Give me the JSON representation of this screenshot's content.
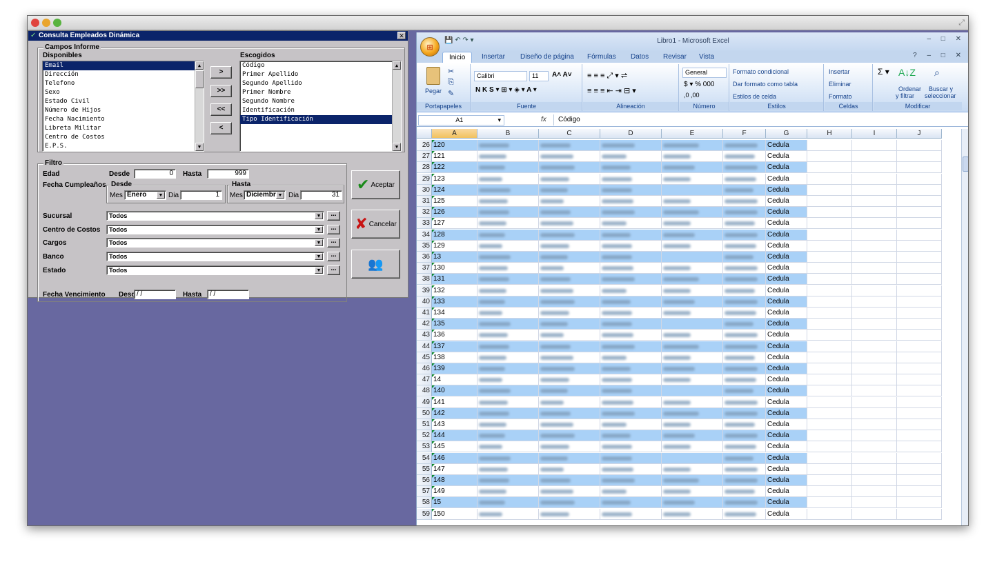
{
  "dialog": {
    "title": "Consulta Empleados Dinámica",
    "campos_title": "Campos Informe",
    "disponibles_label": "Disponibles",
    "escogidos_label": "Escogidos",
    "disponibles": [
      "Email",
      "Dirección",
      "Telefono",
      "Sexo",
      "Estado Civil",
      "Número de Hijos",
      "Fecha Nacimiento",
      "Libreta Militar",
      "Centro de Costos",
      "E.P.S."
    ],
    "escogidos": [
      "Código",
      "Primer Apellido",
      "Segundo Apellido",
      "Primer Nombre",
      "Segundo Nombre",
      "Identificación",
      "Tipo Identificación"
    ],
    "move_buttons": [
      ">",
      ">>",
      "<<",
      "<"
    ],
    "filtro_title": "Filtro",
    "edad_label": "Edad",
    "desde_label": "Desde",
    "hasta_label": "Hasta",
    "edad_desde": "0",
    "edad_hasta": "999",
    "fecha_cumple_label": "Fecha Cumpleaños",
    "mes_label": "Mes",
    "dia_label": "Dia",
    "mes_desde": "Enero",
    "dia_desde": "1",
    "mes_hasta": "Diciembr",
    "dia_hasta": "31",
    "filters": [
      {
        "label": "Sucursal",
        "value": "Todos"
      },
      {
        "label": "Centro de Costos",
        "value": "Todos"
      },
      {
        "label": "Cargos",
        "value": "Todos"
      },
      {
        "label": "Banco",
        "value": "Todos"
      },
      {
        "label": "Estado",
        "value": "Todos"
      }
    ],
    "ellipsis": "...",
    "fecha_venc_label": "Fecha Vencimiento",
    "fecha_venc_desde": "/ /",
    "fecha_venc_hasta": "/ /",
    "aceptar": "Aceptar",
    "cancelar": "Cancelar"
  },
  "excel": {
    "title": "Libro1 - Microsoft Excel",
    "tabs": [
      "Inicio",
      "Insertar",
      "Diseño de página",
      "Fórmulas",
      "Datos",
      "Revisar",
      "Vista"
    ],
    "ribbon": {
      "pegar": "Pegar",
      "portapapeles": "Portapapeles",
      "font_name": "Calibri",
      "font_size": "11",
      "fuente": "Fuente",
      "alineacion": "Alineación",
      "number_format": "General",
      "numero": "Número",
      "formato_condicional": "Formato condicional",
      "dar_formato_tabla": "Dar formato como tabla",
      "estilos_celda": "Estilos de celda",
      "estilos": "Estilos",
      "insertar": "Insertar",
      "eliminar": "Eliminar",
      "formato": "Formato",
      "celdas": "Celdas",
      "ordenar": "Ordenar",
      "filtrar": "y filtrar",
      "buscar": "Buscar y",
      "seleccionar": "seleccionar",
      "modificar": "Modificar"
    },
    "name_box": "A1",
    "formula": "Código",
    "fx": "fx",
    "columns": [
      "A",
      "B",
      "C",
      "D",
      "E",
      "F",
      "G",
      "H",
      "I",
      "J"
    ],
    "rows": [
      {
        "n": "26",
        "a": "120",
        "g": "Cedula"
      },
      {
        "n": "27",
        "a": "121",
        "g": "Cedula"
      },
      {
        "n": "28",
        "a": "122",
        "g": "Cedula"
      },
      {
        "n": "29",
        "a": "123",
        "g": "Cedula"
      },
      {
        "n": "30",
        "a": "124",
        "g": "Cedula"
      },
      {
        "n": "31",
        "a": "125",
        "g": "Cedula"
      },
      {
        "n": "32",
        "a": "126",
        "g": "Cedula"
      },
      {
        "n": "33",
        "a": "127",
        "g": "Cedula"
      },
      {
        "n": "34",
        "a": "128",
        "g": "Cedula"
      },
      {
        "n": "35",
        "a": "129",
        "g": "Cedula"
      },
      {
        "n": "36",
        "a": "13",
        "g": "Cedula"
      },
      {
        "n": "37",
        "a": "130",
        "g": "Cedula"
      },
      {
        "n": "38",
        "a": "131",
        "g": "Cedula"
      },
      {
        "n": "39",
        "a": "132",
        "g": "Cedula"
      },
      {
        "n": "40",
        "a": "133",
        "g": "Cedula"
      },
      {
        "n": "41",
        "a": "134",
        "g": "Cedula"
      },
      {
        "n": "42",
        "a": "135",
        "g": "Cedula"
      },
      {
        "n": "43",
        "a": "136",
        "g": "Cedula"
      },
      {
        "n": "44",
        "a": "137",
        "g": "Cedula"
      },
      {
        "n": "45",
        "a": "138",
        "g": "Cedula"
      },
      {
        "n": "46",
        "a": "139",
        "g": "Cedula"
      },
      {
        "n": "47",
        "a": "14",
        "g": "Cedula"
      },
      {
        "n": "48",
        "a": "140",
        "g": "Cedula"
      },
      {
        "n": "49",
        "a": "141",
        "g": "Cedula"
      },
      {
        "n": "50",
        "a": "142",
        "g": "Cedula"
      },
      {
        "n": "51",
        "a": "143",
        "g": "Cedula"
      },
      {
        "n": "52",
        "a": "144",
        "g": "Cedula"
      },
      {
        "n": "53",
        "a": "145",
        "g": "Cedula"
      },
      {
        "n": "54",
        "a": "146",
        "g": "Cedula"
      },
      {
        "n": "55",
        "a": "147",
        "g": "Cedula"
      },
      {
        "n": "56",
        "a": "148",
        "g": "Cedula"
      },
      {
        "n": "57",
        "a": "149",
        "g": "Cedula"
      },
      {
        "n": "58",
        "a": "15",
        "g": "Cedula"
      },
      {
        "n": "59",
        "a": "150",
        "g": "Cedula"
      }
    ]
  }
}
